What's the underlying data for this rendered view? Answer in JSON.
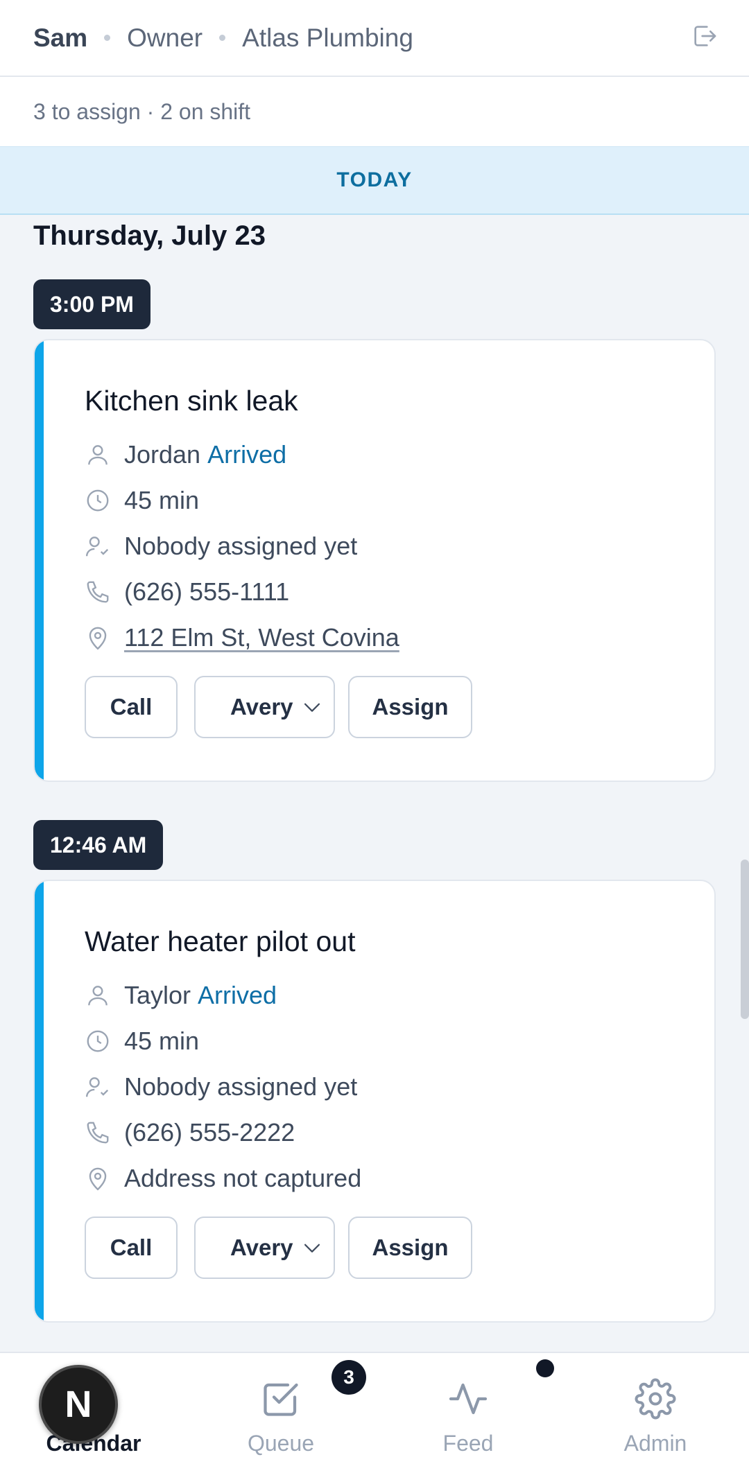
{
  "header": {
    "user": "Sam",
    "role": "Owner",
    "company": "Atlas Plumbing"
  },
  "summary": "3 to assign · 2 on shift",
  "today_label": "TODAY",
  "day_heading": "Thursday, July 23",
  "jobs": [
    {
      "time": "3:00 PM",
      "title": "Kitchen sink leak",
      "customer": "Jordan",
      "status": "Arrived",
      "duration": "45 min",
      "assignee": "Nobody assigned yet",
      "phone": "(626) 555-1111",
      "address": "112 Elm St, West Covina",
      "call_label": "Call",
      "tech_select": "Avery",
      "assign_label": "Assign"
    },
    {
      "time": "12:46 AM",
      "title": "Water heater pilot out",
      "customer": "Taylor",
      "status": "Arrived",
      "duration": "45 min",
      "assignee": "Nobody assigned yet",
      "phone": "(626) 555-2222",
      "address": "Address not captured",
      "call_label": "Call",
      "tech_select": "Avery",
      "assign_label": "Assign"
    }
  ],
  "nav": {
    "calendar": "Calendar",
    "queue": "Queue",
    "queue_badge": "3",
    "feed": "Feed",
    "admin": "Admin"
  },
  "dev_badge": "N",
  "colors": {
    "accent": "#0ea5e9",
    "status": "#0e6ea6",
    "pill": "#1e293b",
    "today_bg": "#dff0fb"
  }
}
